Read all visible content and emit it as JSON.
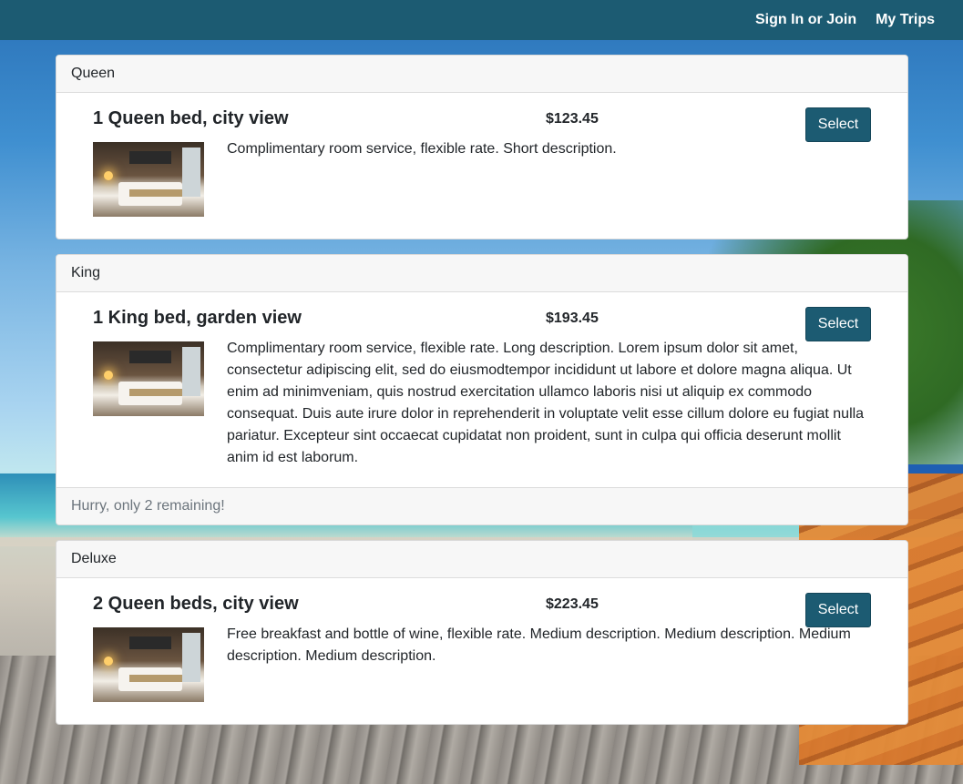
{
  "nav": {
    "sign_in": "Sign In or Join",
    "my_trips": "My Trips"
  },
  "rooms": [
    {
      "category": "Queen",
      "title": "1 Queen bed, city view",
      "price": "$123.45",
      "select_label": "Select",
      "description": "Complimentary room service, flexible rate. Short description.",
      "footer": ""
    },
    {
      "category": "King",
      "title": "1 King bed, garden view",
      "price": "$193.45",
      "select_label": "Select",
      "description": "Complimentary room service, flexible rate. Long description. Lorem ipsum dolor sit amet, consectetur adipiscing elit, sed do eiusmodtempor incididunt ut labore et dolore magna aliqua. Ut enim ad minimveniam, quis nostrud exercitation ullamco laboris nisi ut aliquip ex commodo consequat. Duis aute irure dolor in reprehenderit in voluptate velit esse cillum dolore eu fugiat nulla pariatur. Excepteur sint occaecat cupidatat non proident, sunt in culpa qui officia deserunt mollit anim id est laborum.",
      "footer": "Hurry, only 2 remaining!"
    },
    {
      "category": "Deluxe",
      "title": "2 Queen beds, city view",
      "price": "$223.45",
      "select_label": "Select",
      "description": "Free breakfast and bottle of wine, flexible rate. Medium description. Medium description. Medium description. Medium description.",
      "footer": ""
    }
  ],
  "colors": {
    "nav_bg": "#1c5b72",
    "button_bg": "#1c5b72",
    "header_bg": "#f7f7f7"
  }
}
